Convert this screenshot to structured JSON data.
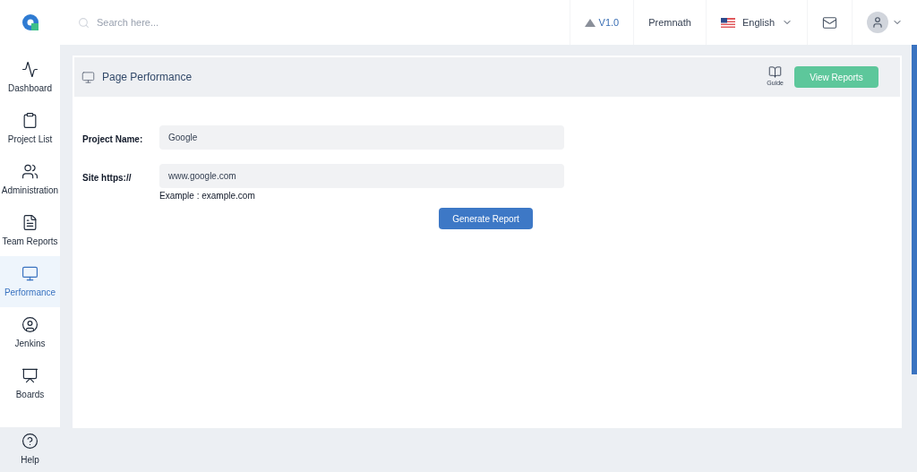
{
  "header": {
    "search": {
      "placeholder": "Search here..."
    },
    "version": "V1.0",
    "user": "Premnath",
    "language": "English"
  },
  "sidebar": {
    "items": [
      {
        "label": "Dashboard",
        "selected": false
      },
      {
        "label": "Project List",
        "selected": false
      },
      {
        "label": "Administration",
        "selected": false
      },
      {
        "label": "Team Reports",
        "selected": false
      },
      {
        "label": "Performance",
        "selected": true
      },
      {
        "label": "Jenkins",
        "selected": false
      },
      {
        "label": "Boards",
        "selected": false
      }
    ],
    "help": "Help"
  },
  "panel": {
    "title": "Page Performance",
    "guide": "Guide",
    "view_reports": "View Reports",
    "fields": [
      {
        "label": "Project Name:",
        "value": "Google"
      },
      {
        "label": "Site https://",
        "value": "www.google.com",
        "hint": "Example : example.com"
      }
    ],
    "submit": "Generate Report"
  }
}
